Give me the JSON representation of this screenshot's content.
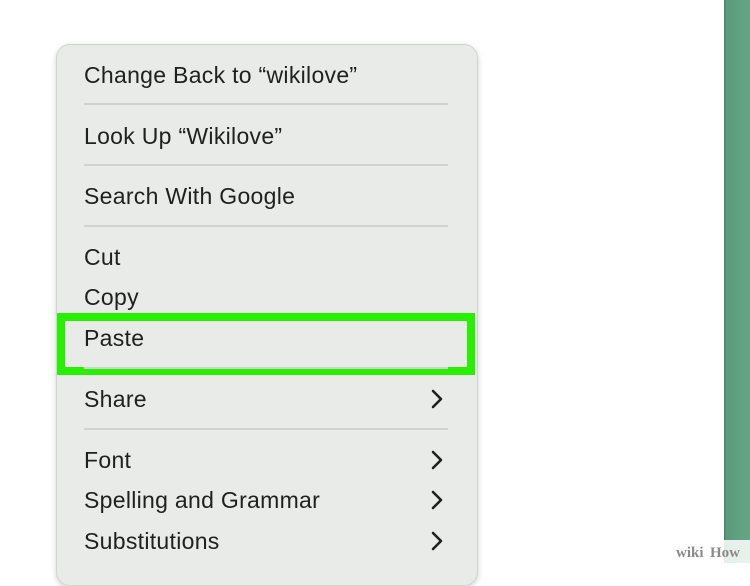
{
  "context_menu": {
    "items": [
      {
        "label": "Change Back to “wikilove”",
        "submenu": false
      },
      {
        "label": "Look Up “Wikilove”",
        "submenu": false
      },
      {
        "label": "Search With Google",
        "submenu": false
      },
      {
        "label": "Cut",
        "submenu": false
      },
      {
        "label": "Copy",
        "submenu": false
      },
      {
        "label": "Paste",
        "submenu": false,
        "highlighted": true
      },
      {
        "label": "Share",
        "submenu": true
      },
      {
        "label": "Font",
        "submenu": true
      },
      {
        "label": "Spelling and Grammar",
        "submenu": true
      },
      {
        "label": "Substitutions",
        "submenu": true
      }
    ],
    "submenu_icon": "chevron-right-icon"
  },
  "highlight": {
    "color": "#28f000",
    "target": "Paste"
  },
  "watermark": {
    "text_wiki": "wiki",
    "text_how": "How",
    "color": "#7a7a7a"
  },
  "colors": {
    "menu_background": "#e9ebe9",
    "separator": "#d0d2d0",
    "right_edge": "#5a9a7a"
  }
}
